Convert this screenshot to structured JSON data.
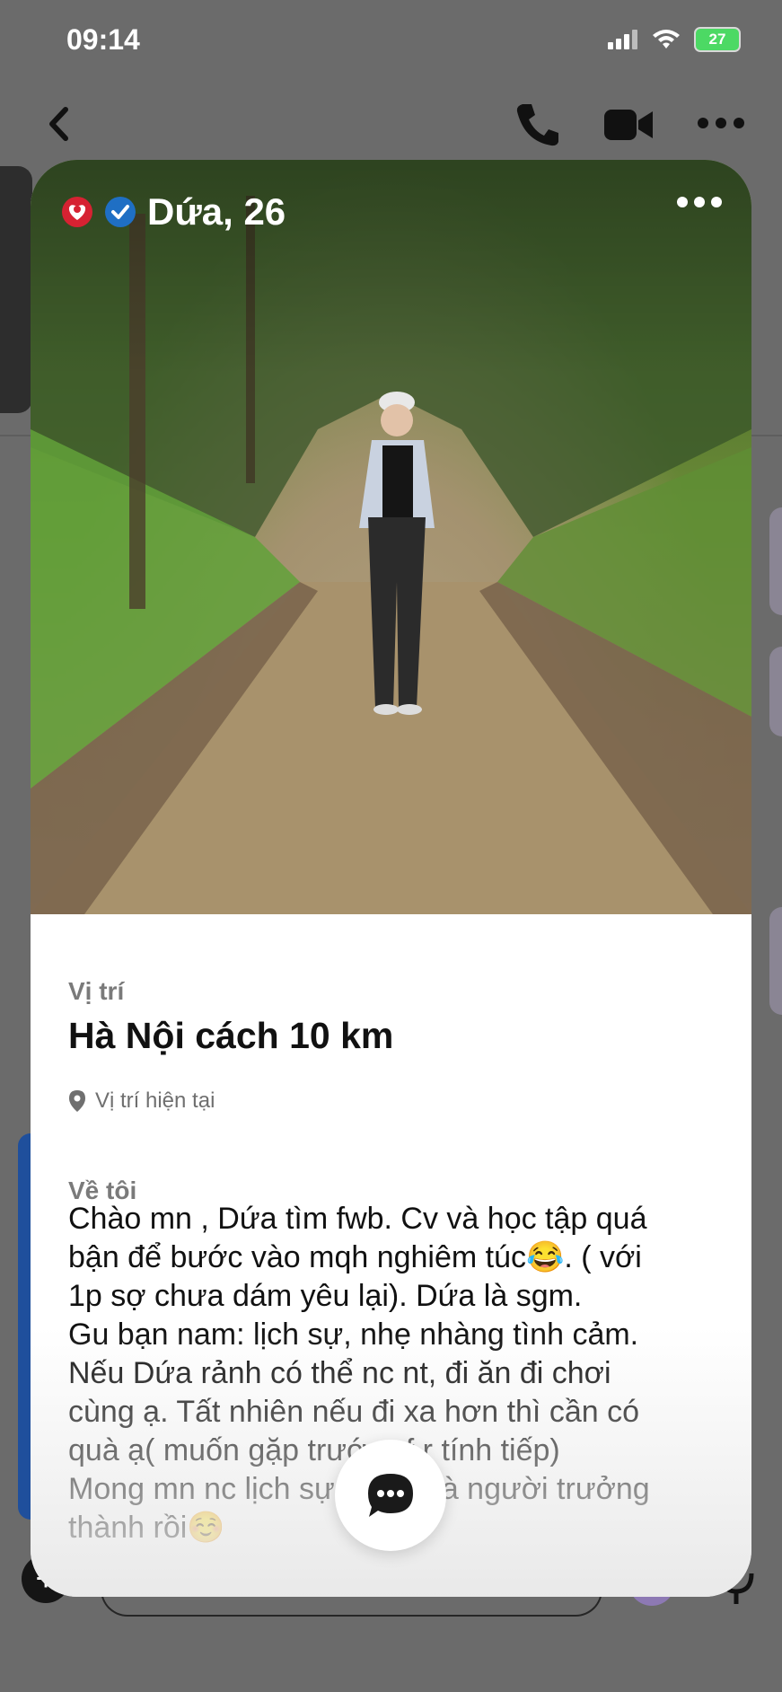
{
  "status_bar": {
    "time": "09:14",
    "battery": "27"
  },
  "profile": {
    "name_age": "Dứa, 26",
    "location": {
      "label": "Vị trí",
      "value": "Hà Nội cách 10 km",
      "sub": "Vị trí hiện tại"
    },
    "about": {
      "label": "Về tôi",
      "text": "Chào mn , Dứa tìm fwb. Cv và học tập quá\nbận để bước vào mqh nghiêm túc😂. ( với\n1p sợ chưa dám yêu lại). Dứa là sgm.\nGu bạn nam: lịch sự, nhẹ nhàng tình cảm.\nNếu Dứa rảnh có thể nc nt, đi ăn đi chơi\ncùng ạ. Tất nhiên nếu đi xa hơn thì cần có\nquà ạ( muốn gặp trước cf r tính tiếp)\nMong mn nc lịch sự vì đều là người trưởng\nthành rồi☺️"
    }
  },
  "icons": {
    "back": "chevron-left-icon",
    "call": "phone-icon",
    "video": "video-camera-icon",
    "more": "more-dots-icon",
    "badge": "red-heart-badge-icon",
    "verified": "verified-check-icon",
    "location_pin": "location-pin-icon",
    "chat": "chat-bubble-icon",
    "plus": "plus-icon",
    "mic": "microphone-icon"
  },
  "colors": {
    "overlay": "#6b6b6b",
    "verified_blue": "#1f6fc4",
    "badge_red": "#d62232",
    "battery_green": "#4cd964"
  }
}
